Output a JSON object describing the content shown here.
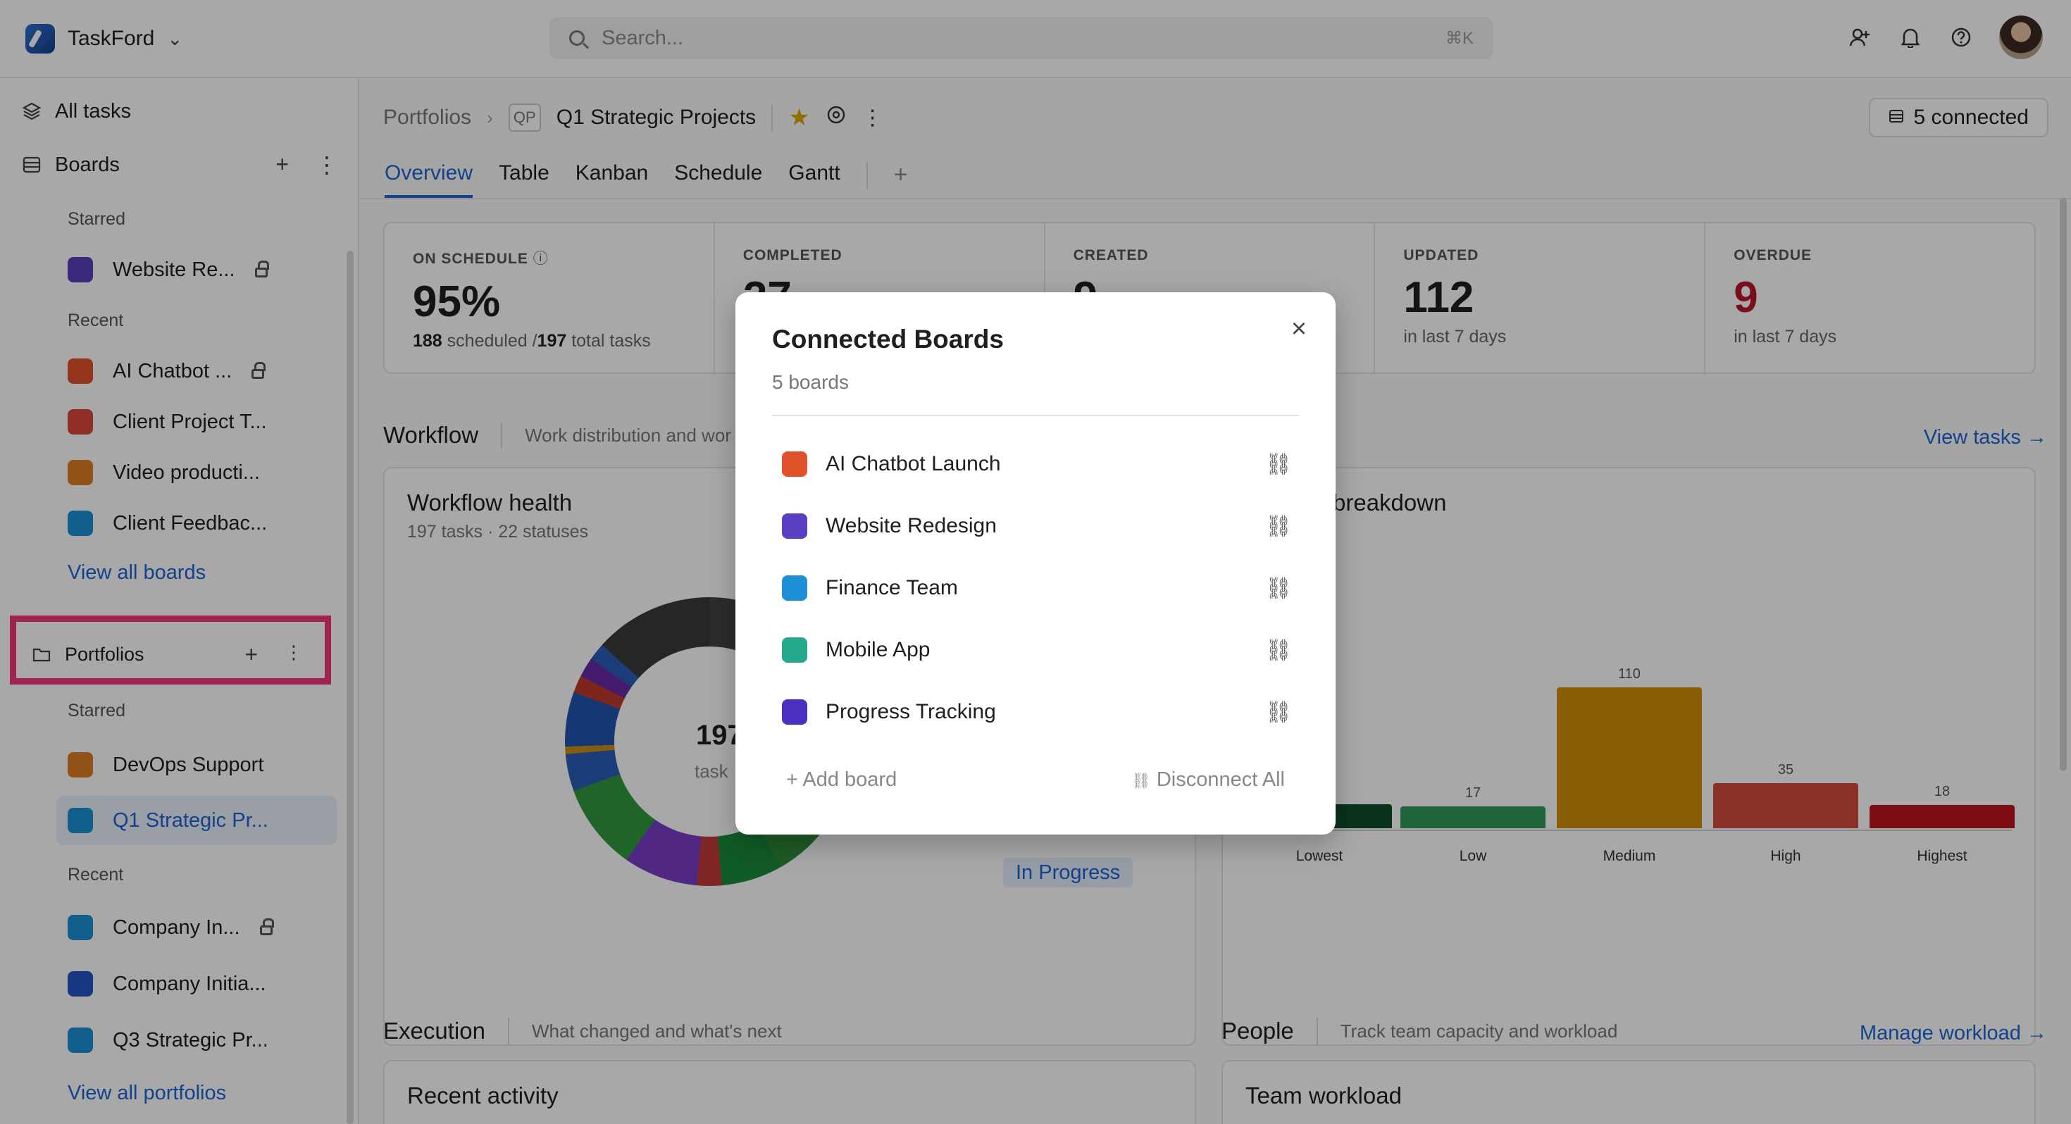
{
  "app": {
    "name": "TaskFord",
    "search_placeholder": "Search...",
    "search_shortcut": "⌘K"
  },
  "icons": {
    "add_user": "add-user-icon",
    "bell": "bell-icon",
    "help": "help-icon",
    "unlink": "unlink-icon",
    "close": "close-icon"
  },
  "sidebar": {
    "all_tasks": "All tasks",
    "boards": "Boards",
    "starred_label": "Starred",
    "recent_label": "Recent",
    "boards_starred": [
      {
        "label": "Website Re...",
        "locked": true,
        "color": "#5a3fc0"
      }
    ],
    "boards_recent": [
      {
        "label": "AI Chatbot ...",
        "locked": true,
        "color": "#e0522a"
      },
      {
        "label": "Client Project T...",
        "locked": false,
        "color": "#d9483b"
      },
      {
        "label": "Video producti...",
        "locked": false,
        "color": "#e07f22"
      },
      {
        "label": "Client Feedbac...",
        "locked": false,
        "color": "#1c8fd6"
      }
    ],
    "view_all_boards": "View all boards",
    "portfolios": "Portfolios",
    "portfolios_starred": [
      {
        "label": "DevOps Support",
        "color": "#e07f22"
      },
      {
        "label": "Q1 Strategic Pr...",
        "color": "#1c8fd6"
      }
    ],
    "portfolios_recent": [
      {
        "label": "Company In...",
        "locked": true,
        "color": "#1c8fd6"
      },
      {
        "label": "Company Initia...",
        "locked": false,
        "color": "#2255c4"
      },
      {
        "label": "Q3 Strategic Pr...",
        "locked": false,
        "color": "#1c8fd6"
      }
    ],
    "view_all_portfolios": "View all portfolios"
  },
  "header": {
    "breadcrumb_root": "Portfolios",
    "badge": "QP",
    "title": "Q1 Strategic Projects",
    "connected": "5 connected",
    "tabs": [
      "Overview",
      "Table",
      "Kanban",
      "Schedule",
      "Gantt"
    ],
    "active_tab": "Overview"
  },
  "stats": [
    {
      "label": "ON SCHEDULE",
      "value": "95%",
      "sub_a": "188",
      "sub_b": " scheduled /",
      "sub_c": "197",
      "sub_d": " total tasks"
    },
    {
      "label": "COMPLETED",
      "value": "27",
      "sub": ""
    },
    {
      "label": "CREATED",
      "value": "9",
      "sub": ""
    },
    {
      "label": "UPDATED",
      "value": "112",
      "sub": "in last 7 days"
    },
    {
      "label": "OVERDUE",
      "value": "9",
      "sub": "in last 7 days"
    }
  ],
  "workflow": {
    "title": "Workflow",
    "desc": "Work distribution and wor",
    "view_tasks": "View tasks →",
    "health_title": "Workflow health",
    "health_sub": "197 tasks · 22 statuses",
    "donut_value": "197",
    "donut_label": "task",
    "in_progress": "In Progress",
    "priority_title": "breakdown"
  },
  "chart_data": {
    "type": "bar",
    "title": "",
    "categories": [
      "Lowest",
      "Low",
      "Medium",
      "High",
      "Highest"
    ],
    "values": [
      null,
      17,
      110,
      35,
      18
    ],
    "colors": [
      "#0f4d2a",
      "#2f9a5a",
      "#d18f0c",
      "#d24a3a",
      "#c0141e"
    ]
  },
  "execution": {
    "title": "Execution",
    "desc": "What changed and what's next",
    "recent_activity": "Recent activity"
  },
  "people": {
    "title": "People",
    "desc": "Track team capacity and workload",
    "link": "Manage workload →",
    "team_workload": "Team workload"
  },
  "modal": {
    "title": "Connected Boards",
    "subtitle": "5 boards",
    "boards": [
      {
        "label": "AI Chatbot Launch",
        "color": "#e0522a"
      },
      {
        "label": "Website Redesign",
        "color": "#5a3fc0"
      },
      {
        "label": "Finance Team",
        "color": "#1c8fd6"
      },
      {
        "label": "Mobile App",
        "color": "#25a88c"
      },
      {
        "label": "Progress Tracking",
        "color": "#4a2fc0"
      }
    ],
    "add_board": "+ Add board",
    "disconnect_all": "Disconnect All"
  }
}
